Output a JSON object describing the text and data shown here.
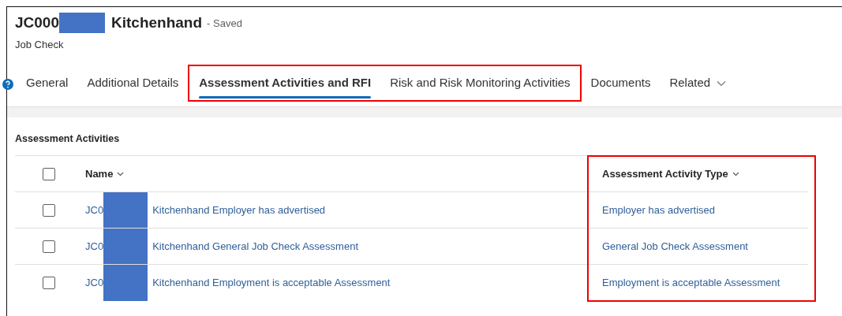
{
  "header": {
    "title_start": "JC000",
    "title_end": "Kitchenhand",
    "status": "- Saved",
    "subtitle": "Job Check"
  },
  "tabs": [
    {
      "label": "General",
      "selected": false,
      "highlighted": false,
      "dropdown": false
    },
    {
      "label": "Additional Details",
      "selected": false,
      "highlighted": false,
      "dropdown": false
    },
    {
      "label": "Assessment Activities and RFI",
      "selected": true,
      "highlighted": true,
      "dropdown": false
    },
    {
      "label": "Risk and Risk Monitoring Activities",
      "selected": false,
      "highlighted": true,
      "dropdown": false
    },
    {
      "label": "Documents",
      "selected": false,
      "highlighted": false,
      "dropdown": false
    },
    {
      "label": "Related",
      "selected": false,
      "highlighted": false,
      "dropdown": true
    }
  ],
  "section": {
    "title": "Assessment Activities",
    "select_all": {
      "checked": false
    },
    "columns": [
      {
        "label": "Name",
        "highlighted": false
      },
      {
        "label": "Assessment Activity Type",
        "highlighted": true
      }
    ],
    "rows": [
      {
        "checked": false,
        "name_start": "JC0",
        "name_end": "Kitchenhand Employer has advertised",
        "type": "Employer has advertised"
      },
      {
        "checked": false,
        "name_start": "JC0",
        "name_end": "Kitchenhand General Job Check Assessment",
        "type": "General Job Check Assessment"
      },
      {
        "checked": false,
        "name_start": "JC0",
        "name_end": "Kitchenhand Employment is acceptable Assessment",
        "type": "Employment is acceptable Assessment"
      }
    ]
  }
}
